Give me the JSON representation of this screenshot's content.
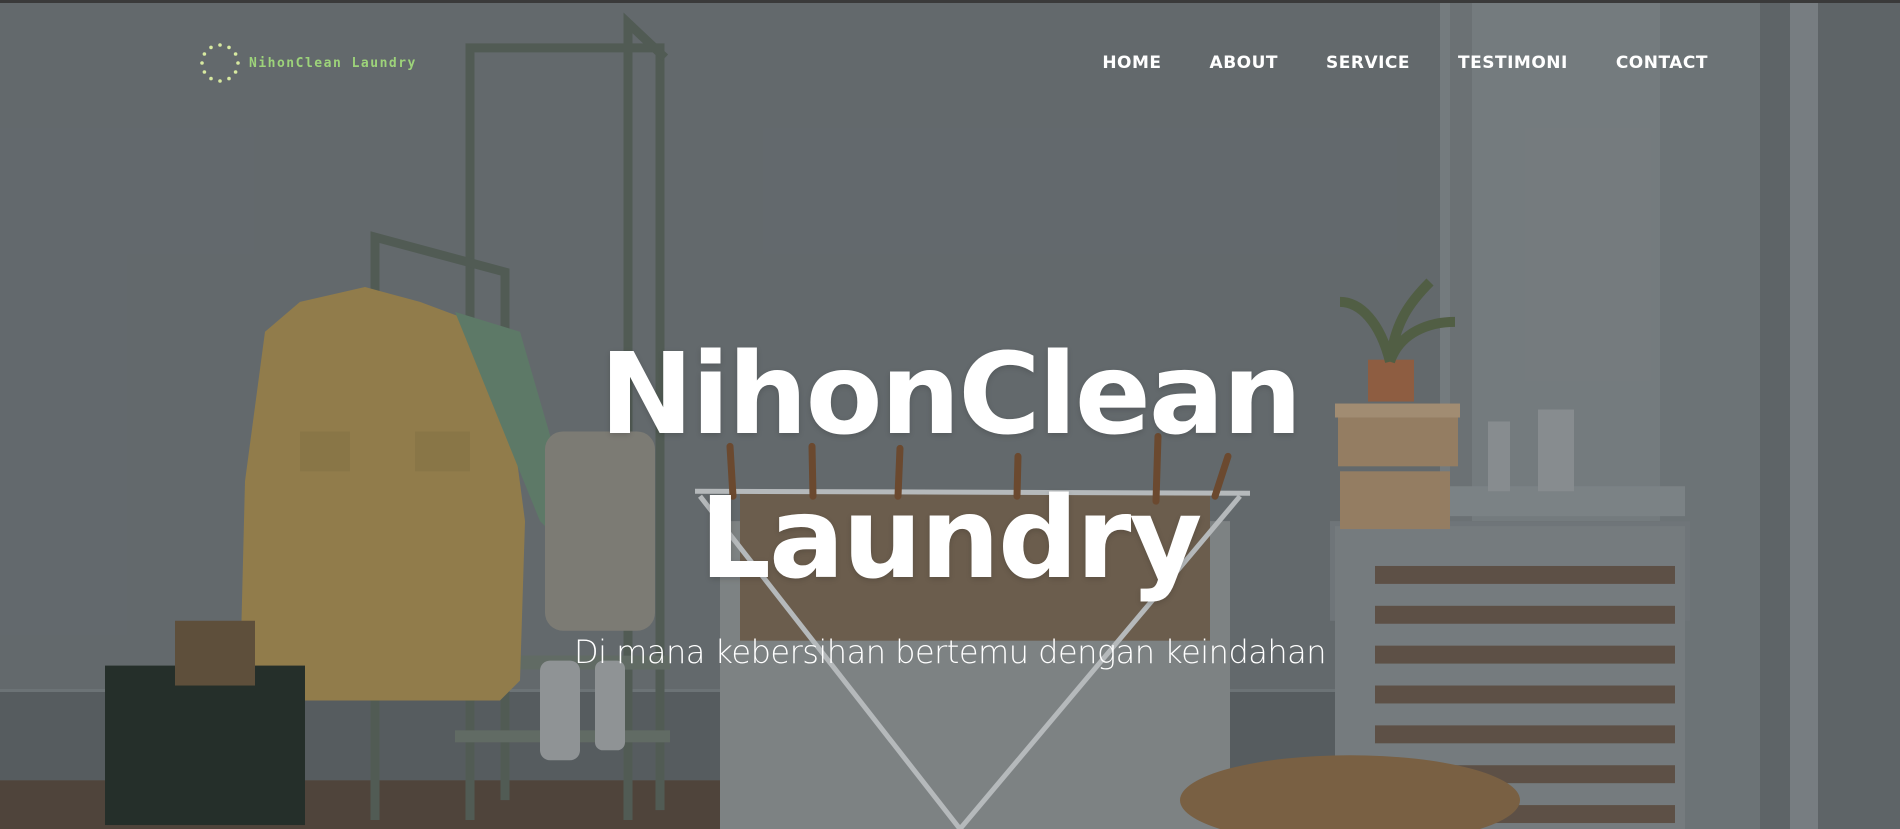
{
  "brand": {
    "name": "NihonClean Laundry",
    "logo_icon": "dotted-circle-icon",
    "accent_color": "#9dd37a"
  },
  "nav": {
    "items": [
      {
        "label": "HOME"
      },
      {
        "label": "ABOUT"
      },
      {
        "label": "SERVICE"
      },
      {
        "label": "TESTIMONI"
      },
      {
        "label": "CONTACT"
      }
    ]
  },
  "hero": {
    "title_line1": "NihonClean",
    "title_line2": "Laundry",
    "subtitle": "Di mana kebersihan bertemu dengan keindahan"
  }
}
